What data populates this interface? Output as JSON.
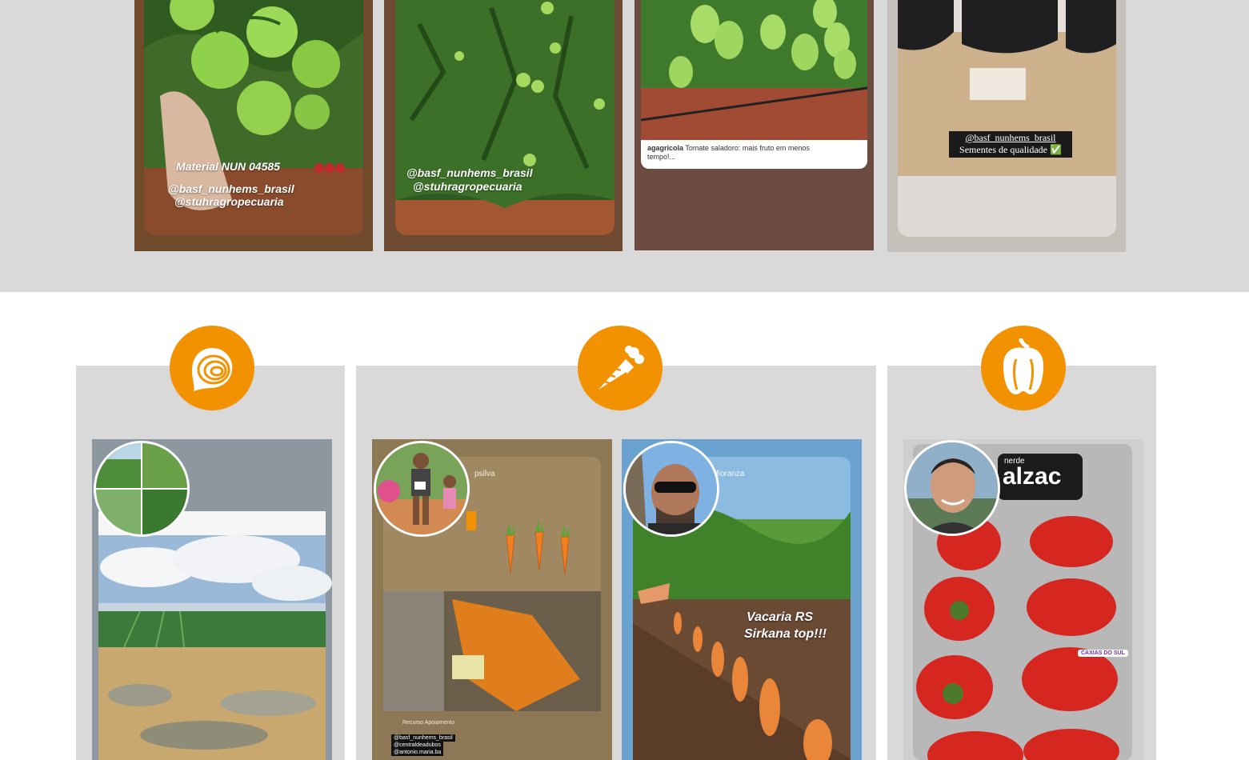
{
  "top_gallery": {
    "stories": [
      {
        "caption_line1": "Material NUN 04585",
        "caption_line2": "@basf_nunhems_brasil",
        "caption_line3": "@stuhragropecuaria"
      },
      {
        "caption_line1": "@basf_nunhems_brasil",
        "caption_line2": "@stuhragropecuaria"
      },
      {
        "author": "agagricola",
        "text": "Tomate saladoro: mais fruto em menos tempo!..."
      },
      {
        "tag_line1": "@basf_nunhems_brasil",
        "tag_line2": "Sementes de qualidade ✅"
      }
    ]
  },
  "crop_sections": [
    {
      "icon": "onion-icon"
    },
    {
      "icon": "carrot-icon"
    },
    {
      "icon": "pepper-icon"
    }
  ],
  "posts": {
    "carrot1": {
      "username_fragment": "psilva",
      "footer_line1": "Recurso Apoiamento",
      "footer_line2": "@basf_nunhems_brasil",
      "footer_line3": "@centraldeadubos",
      "footer_line4": "@antonio.maria.ba"
    },
    "carrot2": {
      "username_fragment": "fioranza",
      "overlay_line1": "Vacaria RS",
      "overlay_line2": "Sirkana top!!!"
    },
    "pepper": {
      "username_fragment": "nerde",
      "title_fragment": "alzac",
      "location_tag": "CAXIAS DO SUL"
    }
  },
  "colors": {
    "accent": "#f39200",
    "band": "#d9d9d9",
    "card": "#d9d9d9"
  }
}
